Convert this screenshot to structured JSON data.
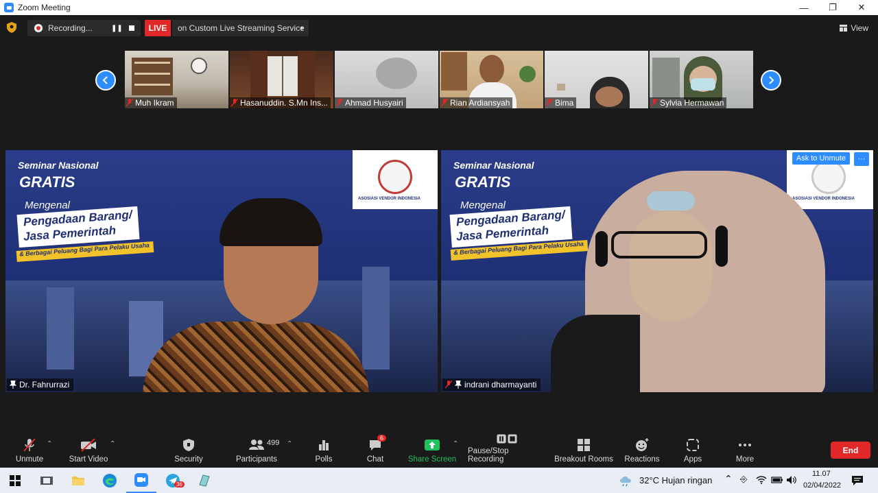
{
  "window": {
    "title": "Zoom Meeting"
  },
  "recording": {
    "label": "Recording..."
  },
  "live": {
    "badge": "LIVE",
    "service": "on Custom Live Streaming Service"
  },
  "view": {
    "label": "View"
  },
  "thumbnails": [
    {
      "name": "Muh Ikram"
    },
    {
      "name": "Hasanuddin. S.Mn Ins..."
    },
    {
      "name": "Ahmad Husyairi"
    },
    {
      "name": "Rian Ardiansyah"
    },
    {
      "name": "Bima"
    },
    {
      "name": "Sylvia Hermawan"
    }
  ],
  "tiles": [
    {
      "name": "Dr. Fahrurrazi"
    },
    {
      "name": "indrani dharmayanti",
      "ask_unmute": "Ask to Unmute",
      "more": "···"
    }
  ],
  "banner": {
    "line1": "Seminar Nasional",
    "line2": "GRATIS",
    "line3": "Mengenal",
    "line4": "Pengadaan Barang/",
    "line5": "Jasa Pemerintah",
    "line6": "& Berbagai Peluang Bagi Para Pelaku Usaha",
    "logo_text": "ASOSIASI VENDOR INDONESIA"
  },
  "toolbar": {
    "unmute": "Unmute",
    "start_video": "Start Video",
    "security": "Security",
    "participants": "Participants",
    "participants_count": "499",
    "polls": "Polls",
    "chat": "Chat",
    "chat_badge": "6",
    "share_screen": "Share Screen",
    "pause_stop": "Pause/Stop Recording",
    "breakout": "Breakout Rooms",
    "reactions": "Reactions",
    "apps": "Apps",
    "more": "More",
    "end": "End"
  },
  "taskbar": {
    "telegram_badge": "36",
    "weather": "32°C  Hujan ringan",
    "time": "11.07",
    "date": "02/04/2022"
  },
  "colors": {
    "accent": "#2d8cff",
    "danger": "#e02828",
    "share": "#20c05c"
  }
}
